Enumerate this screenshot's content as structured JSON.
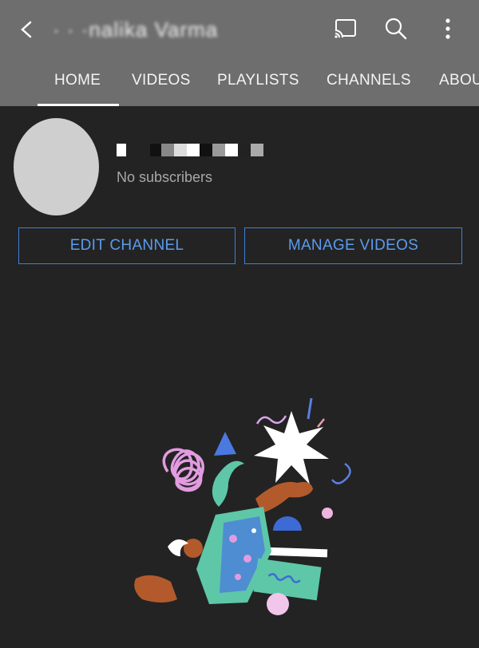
{
  "appbar": {
    "title": "· · ·nalika Varma",
    "icons": [
      "back-arrow-icon",
      "cast-icon",
      "search-icon",
      "more-vert-icon"
    ]
  },
  "tabs": [
    {
      "label": "HOME",
      "active": true
    },
    {
      "label": "VIDEOS"
    },
    {
      "label": "PLAYLISTS"
    },
    {
      "label": "CHANNELS"
    },
    {
      "label": "ABOU"
    }
  ],
  "channel": {
    "subscribers": "No subscribers"
  },
  "buttons": {
    "edit": "EDIT CHANNEL",
    "manage": "MANAGE VIDEOS"
  },
  "colors": {
    "appbar": "#6e6e6e",
    "background": "#232323",
    "accent_blue": "#3f7fd6"
  }
}
